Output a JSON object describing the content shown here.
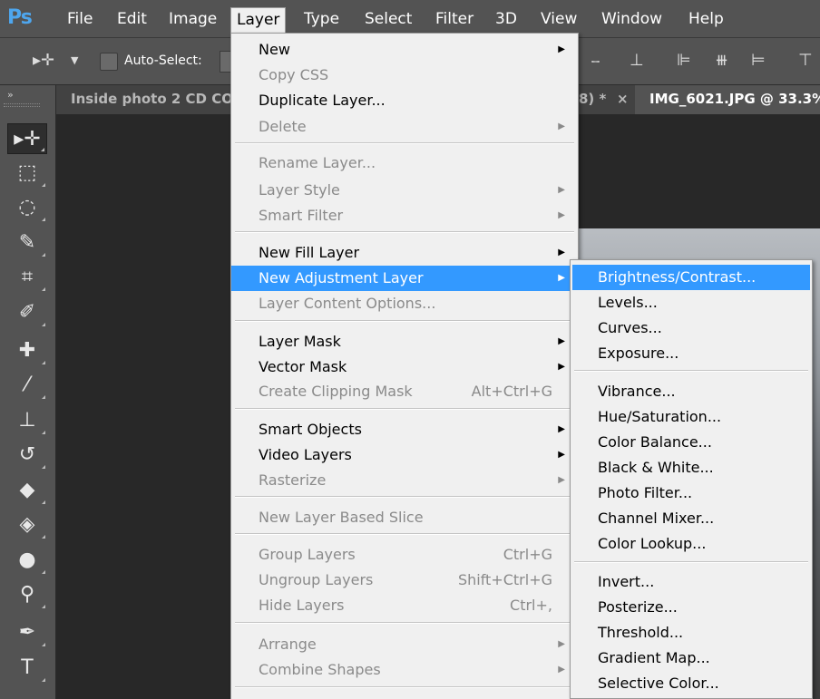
{
  "app": {
    "logo": "Ps"
  },
  "menubar": {
    "items": [
      "File",
      "Edit",
      "Image",
      "Layer",
      "Type",
      "Select",
      "Filter",
      "3D",
      "View",
      "Window",
      "Help"
    ],
    "active": "Layer"
  },
  "options": {
    "auto_select_label": "Auto-Select:"
  },
  "tabs": {
    "tab1": "Inside photo 2 CD CO",
    "tab1_suffix": "8) *",
    "close": "×",
    "tab2": "IMG_6021.JPG @ 33.3%"
  },
  "toolbox": {
    "grip": "»"
  },
  "layer_menu": {
    "new": "New",
    "copy_css": "Copy CSS",
    "duplicate": "Duplicate Layer...",
    "delete": "Delete",
    "rename": "Rename Layer...",
    "layer_style": "Layer Style",
    "smart_filter": "Smart Filter",
    "new_fill": "New Fill Layer",
    "new_adjustment": "New Adjustment Layer",
    "content_options": "Layer Content Options...",
    "layer_mask": "Layer Mask",
    "vector_mask": "Vector Mask",
    "clipping_mask": "Create Clipping Mask",
    "clipping_mask_sc": "Alt+Ctrl+G",
    "smart_objects": "Smart Objects",
    "video_layers": "Video Layers",
    "rasterize": "Rasterize",
    "based_slice": "New Layer Based Slice",
    "group": "Group Layers",
    "group_sc": "Ctrl+G",
    "ungroup": "Ungroup Layers",
    "ungroup_sc": "Shift+Ctrl+G",
    "hide": "Hide Layers",
    "hide_sc": "Ctrl+,",
    "arrange": "Arrange",
    "combine": "Combine Shapes"
  },
  "adjustment_submenu": {
    "items": [
      "Brightness/Contrast...",
      "Levels...",
      "Curves...",
      "Exposure...",
      "Vibrance...",
      "Hue/Saturation...",
      "Color Balance...",
      "Black & White...",
      "Photo Filter...",
      "Channel Mixer...",
      "Color Lookup...",
      "Invert...",
      "Posterize...",
      "Threshold...",
      "Gradient Map...",
      "Selective Color..."
    ]
  },
  "colors": {
    "highlight": "#3399ff",
    "menu_bg": "#f0f0f0",
    "ui_bg": "#535353",
    "canvas_bg": "#282828",
    "logo": "#4ea6ee"
  }
}
